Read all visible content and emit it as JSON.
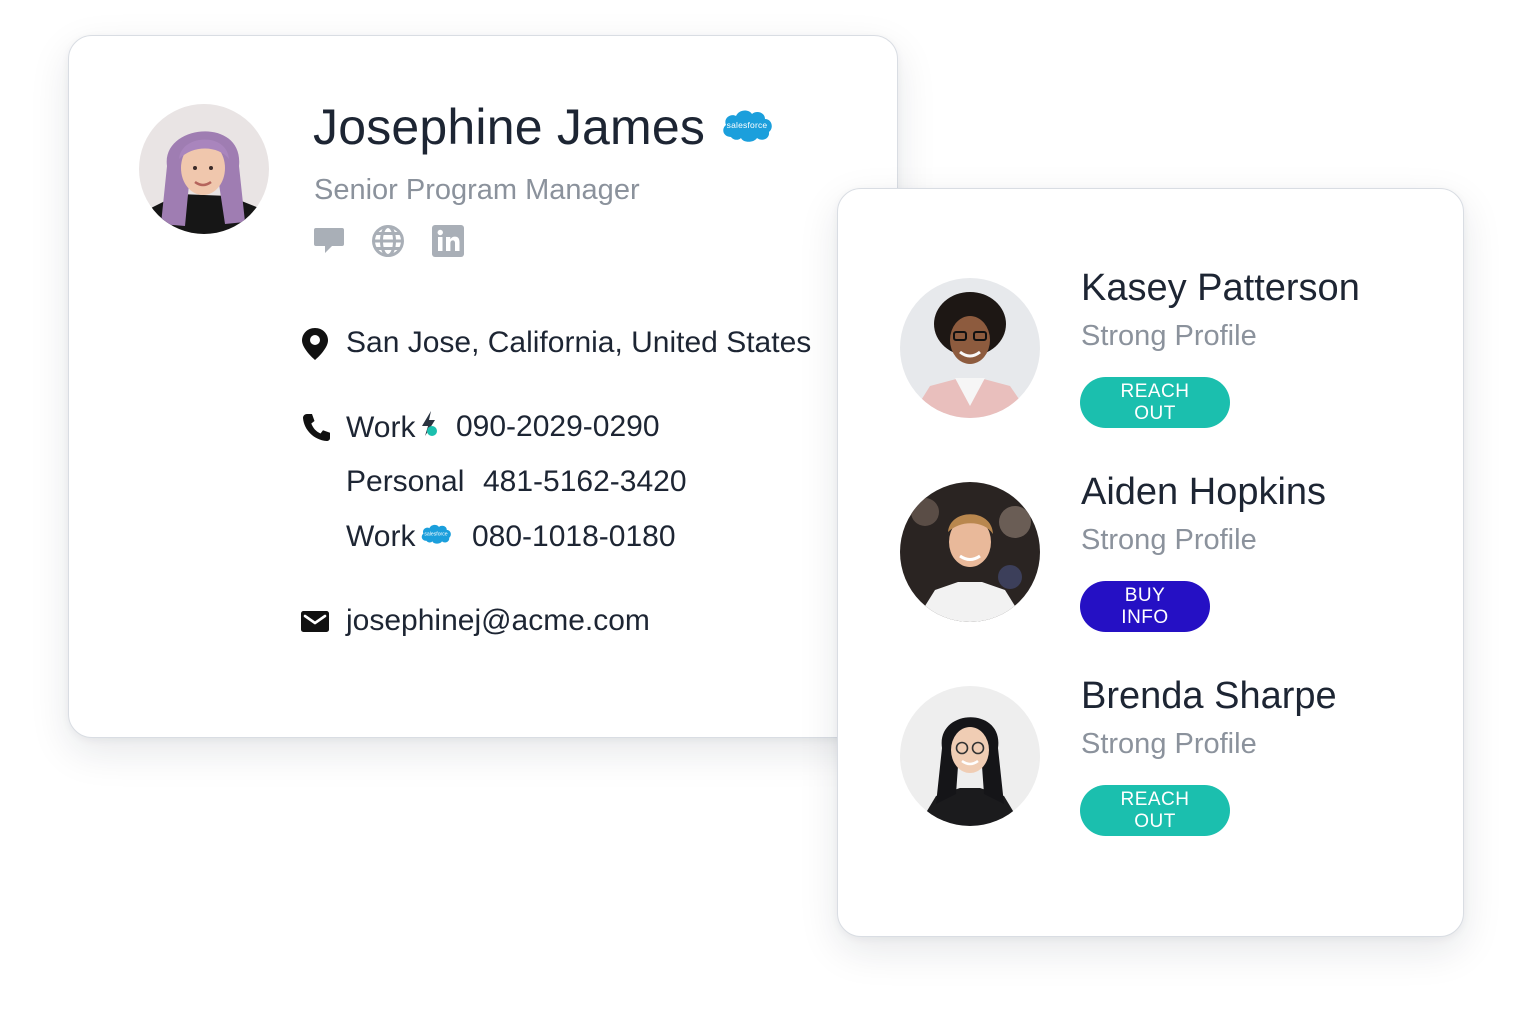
{
  "colors": {
    "teal": "#1bbfae",
    "indigo": "#2510c4",
    "salesforce_blue": "#1b9fdc",
    "muted_gray": "#8b929c",
    "icon_gray": "#a9afb7"
  },
  "profile": {
    "name": "Josephine James",
    "title": "Senior Program Manager",
    "badge_icon": "salesforce-cloud-icon",
    "badge_text": "salesforce",
    "social_icons": [
      "chat-icon",
      "globe-icon",
      "linkedin-icon"
    ],
    "location": "San Jose, California, United States",
    "phones": [
      {
        "label": "Work",
        "number": "090-2029-0290",
        "source_icon": "data-source-icon"
      },
      {
        "label": "Personal",
        "number": "481-5162-3420"
      },
      {
        "label": "Work",
        "number": "080-1018-0180",
        "source_icon": "salesforce-cloud-icon"
      }
    ],
    "email": "josephinej@acme.com"
  },
  "leads": [
    {
      "name": "Kasey Patterson",
      "status": "Strong Profile",
      "action": "REACH OUT",
      "action_color": "teal"
    },
    {
      "name": "Aiden Hopkins",
      "status": "Strong Profile",
      "action": "BUY INFO",
      "action_color": "indigo"
    },
    {
      "name": "Brenda Sharpe",
      "status": "Strong Profile",
      "action": "REACH OUT",
      "action_color": "teal"
    }
  ]
}
